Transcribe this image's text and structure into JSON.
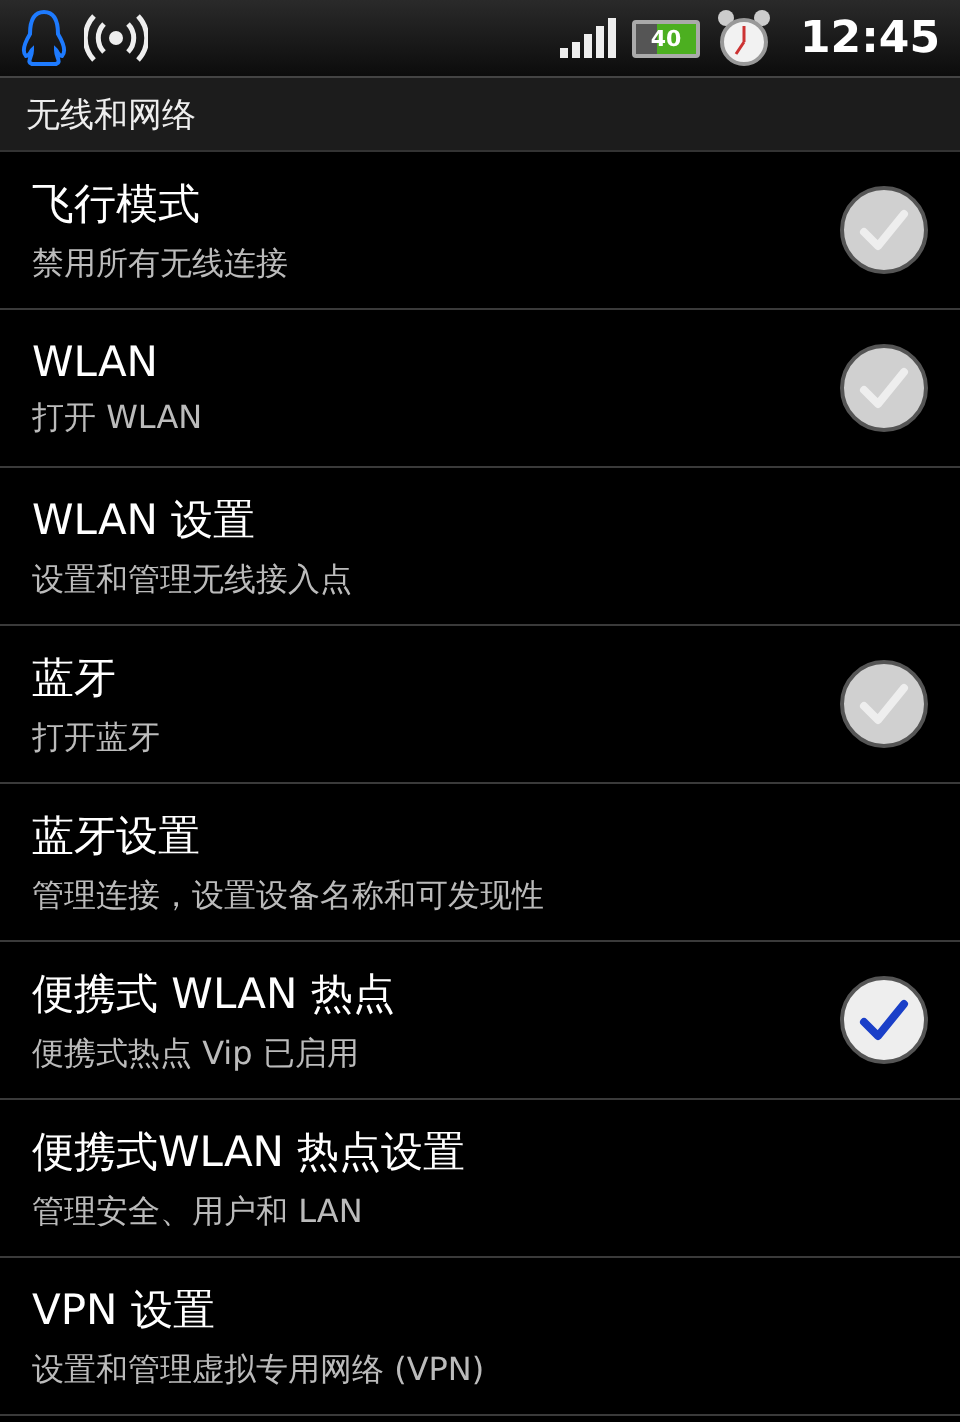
{
  "status_bar": {
    "battery": "40",
    "time": "12:45"
  },
  "section": {
    "title": "无线和网络"
  },
  "rows": [
    {
      "kind": "checkbox",
      "title": "飞行模式",
      "summary": "禁用所有无线连接",
      "checked": false
    },
    {
      "kind": "checkbox",
      "title": "WLAN",
      "summary": "打开 WLAN",
      "checked": false
    },
    {
      "kind": "plain",
      "title": "WLAN 设置",
      "summary": "设置和管理无线接入点"
    },
    {
      "kind": "checkbox",
      "title": "蓝牙",
      "summary": "打开蓝牙",
      "checked": false
    },
    {
      "kind": "plain",
      "title": "蓝牙设置",
      "summary": "管理连接，设置设备名称和可发现性"
    },
    {
      "kind": "checkbox",
      "title": "便携式 WLAN 热点",
      "summary": "便携式热点 Vip 已启用",
      "checked": true
    },
    {
      "kind": "plain",
      "title": "便携式WLAN 热点设置",
      "summary": "管理安全、用户和 LAN"
    },
    {
      "kind": "plain",
      "title": "VPN 设置",
      "summary": "设置和管理虚拟专用网络 (VPN)"
    }
  ]
}
